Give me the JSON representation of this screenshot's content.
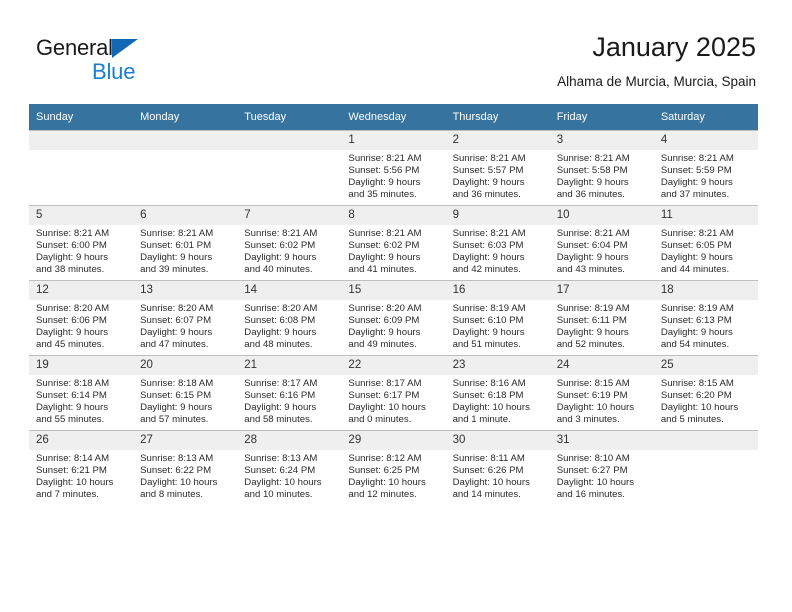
{
  "brand": {
    "name_top": "General",
    "name_bottom": "Blue",
    "triangle_color": "#1268b3",
    "blue_text_color": "#1b7fd4"
  },
  "header": {
    "title": "January 2025",
    "subtitle": "Alhama de Murcia, Murcia, Spain"
  },
  "theme": {
    "header_row_bg": "#36749f",
    "header_row_text": "#ffffff",
    "daynum_bg": "#efefef",
    "cell_border": "#bfbfbf"
  },
  "weekday_headers": [
    "Sunday",
    "Monday",
    "Tuesday",
    "Wednesday",
    "Thursday",
    "Friday",
    "Saturday"
  ],
  "weeks": [
    [
      {
        "day": "",
        "empty": true,
        "sunrise": "",
        "sunset": "",
        "daylight_line1": "",
        "daylight_line2": ""
      },
      {
        "day": "",
        "empty": true,
        "sunrise": "",
        "sunset": "",
        "daylight_line1": "",
        "daylight_line2": ""
      },
      {
        "day": "",
        "empty": true,
        "sunrise": "",
        "sunset": "",
        "daylight_line1": "",
        "daylight_line2": ""
      },
      {
        "day": "1",
        "sunrise": "Sunrise: 8:21 AM",
        "sunset": "Sunset: 5:56 PM",
        "daylight_line1": "Daylight: 9 hours",
        "daylight_line2": "and 35 minutes."
      },
      {
        "day": "2",
        "sunrise": "Sunrise: 8:21 AM",
        "sunset": "Sunset: 5:57 PM",
        "daylight_line1": "Daylight: 9 hours",
        "daylight_line2": "and 36 minutes."
      },
      {
        "day": "3",
        "sunrise": "Sunrise: 8:21 AM",
        "sunset": "Sunset: 5:58 PM",
        "daylight_line1": "Daylight: 9 hours",
        "daylight_line2": "and 36 minutes."
      },
      {
        "day": "4",
        "sunrise": "Sunrise: 8:21 AM",
        "sunset": "Sunset: 5:59 PM",
        "daylight_line1": "Daylight: 9 hours",
        "daylight_line2": "and 37 minutes."
      }
    ],
    [
      {
        "day": "5",
        "sunrise": "Sunrise: 8:21 AM",
        "sunset": "Sunset: 6:00 PM",
        "daylight_line1": "Daylight: 9 hours",
        "daylight_line2": "and 38 minutes."
      },
      {
        "day": "6",
        "sunrise": "Sunrise: 8:21 AM",
        "sunset": "Sunset: 6:01 PM",
        "daylight_line1": "Daylight: 9 hours",
        "daylight_line2": "and 39 minutes."
      },
      {
        "day": "7",
        "sunrise": "Sunrise: 8:21 AM",
        "sunset": "Sunset: 6:02 PM",
        "daylight_line1": "Daylight: 9 hours",
        "daylight_line2": "and 40 minutes."
      },
      {
        "day": "8",
        "sunrise": "Sunrise: 8:21 AM",
        "sunset": "Sunset: 6:02 PM",
        "daylight_line1": "Daylight: 9 hours",
        "daylight_line2": "and 41 minutes."
      },
      {
        "day": "9",
        "sunrise": "Sunrise: 8:21 AM",
        "sunset": "Sunset: 6:03 PM",
        "daylight_line1": "Daylight: 9 hours",
        "daylight_line2": "and 42 minutes."
      },
      {
        "day": "10",
        "sunrise": "Sunrise: 8:21 AM",
        "sunset": "Sunset: 6:04 PM",
        "daylight_line1": "Daylight: 9 hours",
        "daylight_line2": "and 43 minutes."
      },
      {
        "day": "11",
        "sunrise": "Sunrise: 8:21 AM",
        "sunset": "Sunset: 6:05 PM",
        "daylight_line1": "Daylight: 9 hours",
        "daylight_line2": "and 44 minutes."
      }
    ],
    [
      {
        "day": "12",
        "sunrise": "Sunrise: 8:20 AM",
        "sunset": "Sunset: 6:06 PM",
        "daylight_line1": "Daylight: 9 hours",
        "daylight_line2": "and 45 minutes."
      },
      {
        "day": "13",
        "sunrise": "Sunrise: 8:20 AM",
        "sunset": "Sunset: 6:07 PM",
        "daylight_line1": "Daylight: 9 hours",
        "daylight_line2": "and 47 minutes."
      },
      {
        "day": "14",
        "sunrise": "Sunrise: 8:20 AM",
        "sunset": "Sunset: 6:08 PM",
        "daylight_line1": "Daylight: 9 hours",
        "daylight_line2": "and 48 minutes."
      },
      {
        "day": "15",
        "sunrise": "Sunrise: 8:20 AM",
        "sunset": "Sunset: 6:09 PM",
        "daylight_line1": "Daylight: 9 hours",
        "daylight_line2": "and 49 minutes."
      },
      {
        "day": "16",
        "sunrise": "Sunrise: 8:19 AM",
        "sunset": "Sunset: 6:10 PM",
        "daylight_line1": "Daylight: 9 hours",
        "daylight_line2": "and 51 minutes."
      },
      {
        "day": "17",
        "sunrise": "Sunrise: 8:19 AM",
        "sunset": "Sunset: 6:11 PM",
        "daylight_line1": "Daylight: 9 hours",
        "daylight_line2": "and 52 minutes."
      },
      {
        "day": "18",
        "sunrise": "Sunrise: 8:19 AM",
        "sunset": "Sunset: 6:13 PM",
        "daylight_line1": "Daylight: 9 hours",
        "daylight_line2": "and 54 minutes."
      }
    ],
    [
      {
        "day": "19",
        "sunrise": "Sunrise: 8:18 AM",
        "sunset": "Sunset: 6:14 PM",
        "daylight_line1": "Daylight: 9 hours",
        "daylight_line2": "and 55 minutes."
      },
      {
        "day": "20",
        "sunrise": "Sunrise: 8:18 AM",
        "sunset": "Sunset: 6:15 PM",
        "daylight_line1": "Daylight: 9 hours",
        "daylight_line2": "and 57 minutes."
      },
      {
        "day": "21",
        "sunrise": "Sunrise: 8:17 AM",
        "sunset": "Sunset: 6:16 PM",
        "daylight_line1": "Daylight: 9 hours",
        "daylight_line2": "and 58 minutes."
      },
      {
        "day": "22",
        "sunrise": "Sunrise: 8:17 AM",
        "sunset": "Sunset: 6:17 PM",
        "daylight_line1": "Daylight: 10 hours",
        "daylight_line2": "and 0 minutes."
      },
      {
        "day": "23",
        "sunrise": "Sunrise: 8:16 AM",
        "sunset": "Sunset: 6:18 PM",
        "daylight_line1": "Daylight: 10 hours",
        "daylight_line2": "and 1 minute."
      },
      {
        "day": "24",
        "sunrise": "Sunrise: 8:15 AM",
        "sunset": "Sunset: 6:19 PM",
        "daylight_line1": "Daylight: 10 hours",
        "daylight_line2": "and 3 minutes."
      },
      {
        "day": "25",
        "sunrise": "Sunrise: 8:15 AM",
        "sunset": "Sunset: 6:20 PM",
        "daylight_line1": "Daylight: 10 hours",
        "daylight_line2": "and 5 minutes."
      }
    ],
    [
      {
        "day": "26",
        "sunrise": "Sunrise: 8:14 AM",
        "sunset": "Sunset: 6:21 PM",
        "daylight_line1": "Daylight: 10 hours",
        "daylight_line2": "and 7 minutes."
      },
      {
        "day": "27",
        "sunrise": "Sunrise: 8:13 AM",
        "sunset": "Sunset: 6:22 PM",
        "daylight_line1": "Daylight: 10 hours",
        "daylight_line2": "and 8 minutes."
      },
      {
        "day": "28",
        "sunrise": "Sunrise: 8:13 AM",
        "sunset": "Sunset: 6:24 PM",
        "daylight_line1": "Daylight: 10 hours",
        "daylight_line2": "and 10 minutes."
      },
      {
        "day": "29",
        "sunrise": "Sunrise: 8:12 AM",
        "sunset": "Sunset: 6:25 PM",
        "daylight_line1": "Daylight: 10 hours",
        "daylight_line2": "and 12 minutes."
      },
      {
        "day": "30",
        "sunrise": "Sunrise: 8:11 AM",
        "sunset": "Sunset: 6:26 PM",
        "daylight_line1": "Daylight: 10 hours",
        "daylight_line2": "and 14 minutes."
      },
      {
        "day": "31",
        "sunrise": "Sunrise: 8:10 AM",
        "sunset": "Sunset: 6:27 PM",
        "daylight_line1": "Daylight: 10 hours",
        "daylight_line2": "and 16 minutes."
      },
      {
        "day": "",
        "empty": true,
        "sunrise": "",
        "sunset": "",
        "daylight_line1": "",
        "daylight_line2": ""
      }
    ]
  ]
}
